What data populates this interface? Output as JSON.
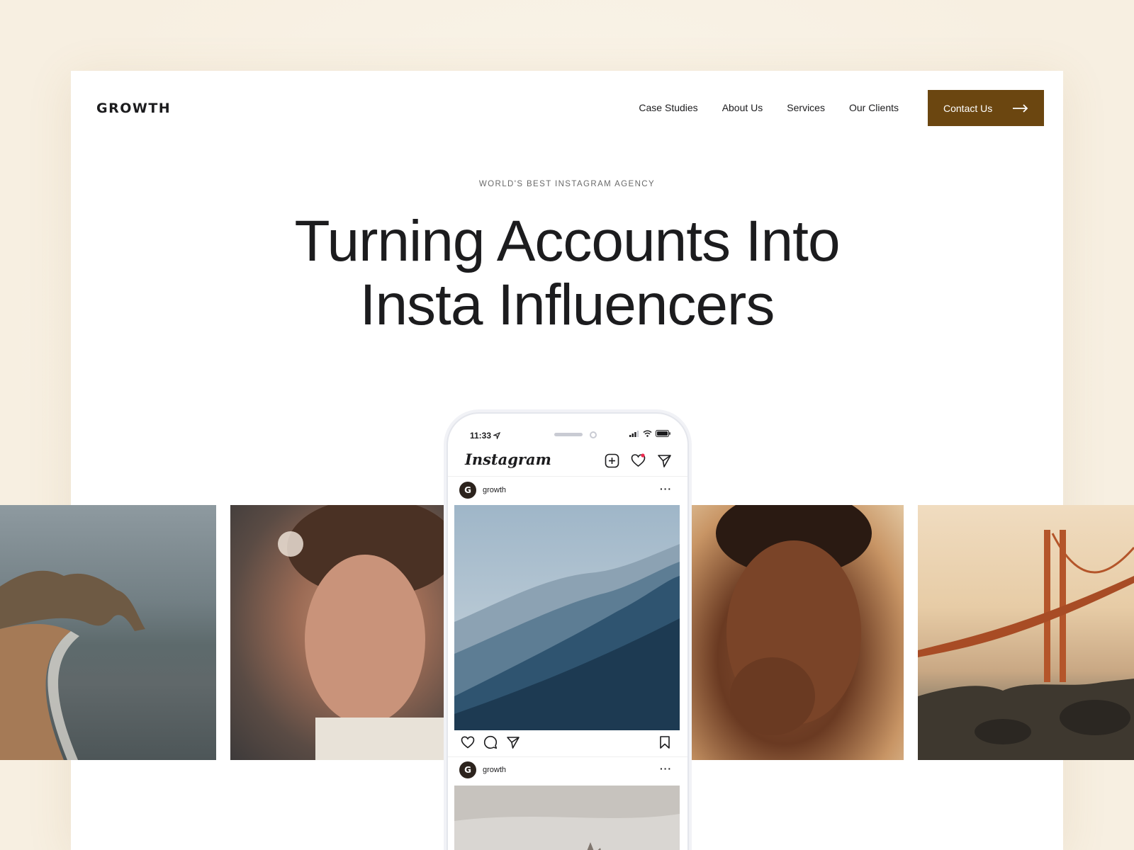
{
  "brand": {
    "logo": "GROWTH",
    "accent_color": "#6b4610"
  },
  "nav": {
    "items": [
      "Case Studies",
      "About Us",
      "Services",
      "Our Clients"
    ],
    "cta_label": "Contact Us"
  },
  "hero": {
    "eyebrow": "WORLD'S BEST INSTAGRAM AGENCY",
    "headline_line1": "Turning Accounts Into",
    "headline_line2": "Insta Influencers"
  },
  "phone": {
    "time": "11:33",
    "app_name": "Instagram",
    "posts": [
      {
        "username": "growth",
        "avatar_letter": "G"
      },
      {
        "username": "growth",
        "avatar_letter": "G"
      }
    ]
  },
  "photos": [
    "beach-arch-photo",
    "young-man-portrait",
    "woman-portrait",
    "golden-gate-bridge-photo"
  ]
}
